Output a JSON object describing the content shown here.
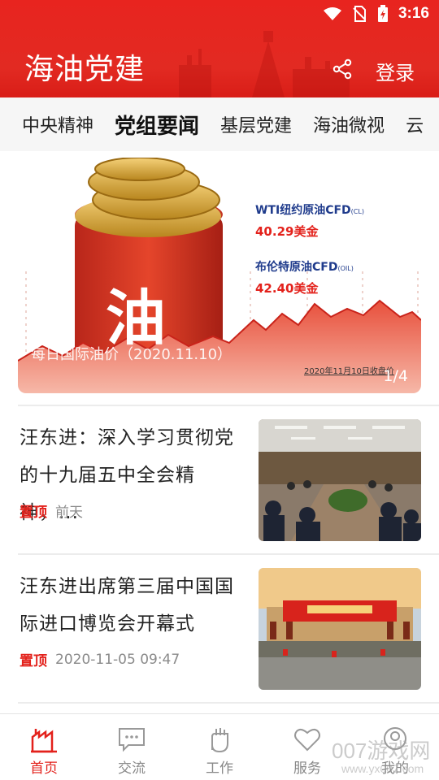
{
  "status_bar": {
    "time": "3:16"
  },
  "header": {
    "title": "海油党建",
    "login_label": "登录"
  },
  "tabs": [
    {
      "label": "中央精神",
      "active": false
    },
    {
      "label": "党组要闻",
      "active": true
    },
    {
      "label": "基层党建",
      "active": false
    },
    {
      "label": "海油微视",
      "active": false
    },
    {
      "label": "云",
      "active": false
    }
  ],
  "banner": {
    "barrel_char": "油",
    "wti_label": "WTI纽约原油CFD",
    "wti_suffix": "(CL)",
    "wti_price": "40.29美金",
    "brent_label": "布伦特原油CFD",
    "brent_suffix": "(OIL)",
    "brent_price": "42.40美金",
    "caption": "每日国际油价（2020.11.10）",
    "close_note": "2020年11月10日收盘价",
    "page_indicator": "1/4"
  },
  "news": [
    {
      "title": "汪东进：深入学习贯彻党的十九届五中全会精神，...",
      "tag": "置顶",
      "time": "前天"
    },
    {
      "title": "汪东进出席第三届中国国际进口博览会开幕式",
      "tag": "置顶",
      "time": "2020-11-05 09:47"
    }
  ],
  "bottom_nav": [
    {
      "label": "首页",
      "icon": "home-factory-icon",
      "active": true
    },
    {
      "label": "交流",
      "icon": "chat-icon",
      "active": false
    },
    {
      "label": "工作",
      "icon": "hand-icon",
      "active": false
    },
    {
      "label": "服务",
      "icon": "heart-icon",
      "active": false
    },
    {
      "label": "我的",
      "icon": "user-icon",
      "active": false
    }
  ],
  "watermark": {
    "text": "007游戏网",
    "sub": "www.yx007.com"
  },
  "colors": {
    "brand_red": "#e3211b",
    "header_red": "#e8241f",
    "title_blue": "#1f3b8c"
  }
}
